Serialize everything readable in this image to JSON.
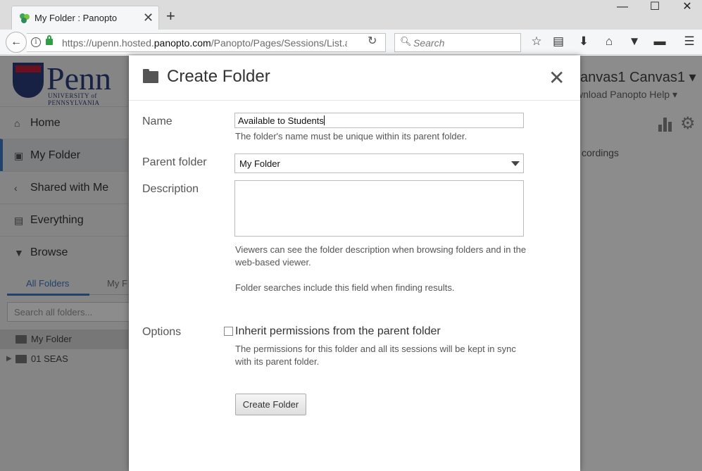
{
  "browser": {
    "tab_title": "My Folder : Panopto",
    "tab_close": "✕",
    "new_tab": "+",
    "url_prefix": "https://upenn.hosted.",
    "url_domain": "panopto.com",
    "url_path": "/Panopto/Pages/Sessions/List.as",
    "search_placeholder": "Search",
    "window_controls": [
      "—",
      "☐",
      "✕"
    ]
  },
  "page": {
    "logo_word": "Penn",
    "logo_sub": "UNIVERSITY of PENNSYLVANIA",
    "user_name": "anvas1 Canvas1 ▾",
    "header_links": "wnload Panopto    Help ▾",
    "nav": [
      {
        "label": "Home",
        "icon": "home-icon"
      },
      {
        "label": "My Folder",
        "icon": "folder-icon"
      },
      {
        "label": "Shared with Me",
        "icon": "share-icon"
      },
      {
        "label": "Everything",
        "icon": "list-icon"
      },
      {
        "label": "Browse",
        "icon": "caret-down-icon"
      }
    ],
    "browse_tabs": [
      "All Folders",
      "My F"
    ],
    "folder_search_placeholder": "Search all folders...",
    "tree": [
      {
        "label": "My Folder"
      },
      {
        "label": "01 SEAS"
      }
    ],
    "recordings_text": "cordings"
  },
  "modal": {
    "title": "Create Folder",
    "close": "✕",
    "name_label": "Name",
    "name_value": "Available to Students",
    "name_help": "The folder's name must be unique within its parent folder.",
    "parent_label": "Parent folder",
    "parent_value": "My Folder",
    "description_label": "Description",
    "description_help_1": "Viewers can see the folder description when browsing folders and in the web-based viewer.",
    "description_help_2": "Folder searches include this field when finding results.",
    "options_label": "Options",
    "inherit_label": "Inherit permissions from the parent folder",
    "inherit_checked": false,
    "inherit_help": "The permissions for this folder and all its sessions will be kept in sync with its parent folder.",
    "submit_label": "Create Folder"
  }
}
